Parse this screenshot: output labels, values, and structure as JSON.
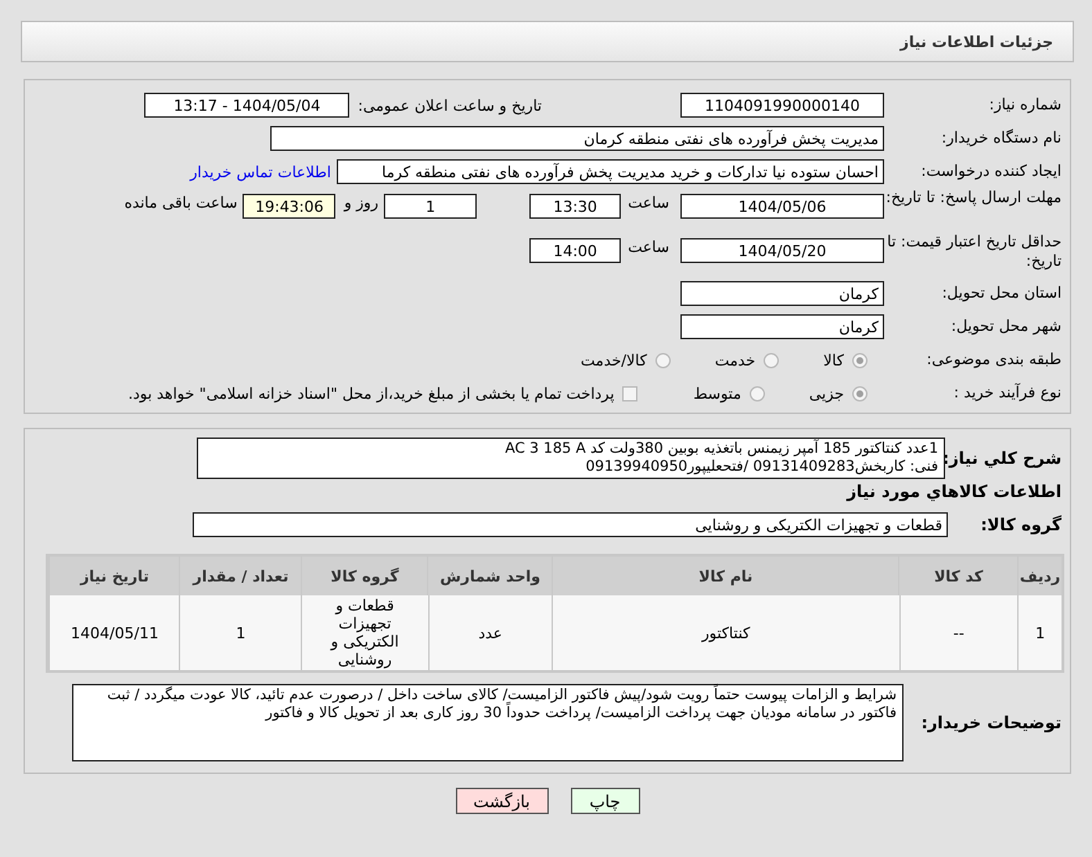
{
  "header": {
    "title": "جزئیات اطلاعات نیاز"
  },
  "need_number": {
    "label": "شماره نیاز:",
    "value": "1104091990000140"
  },
  "announce": {
    "label": "تاریخ و ساعت اعلان عمومی:",
    "value": "1404/05/04 - 13:17"
  },
  "buyer_org": {
    "label": "نام دستگاه خریدار:",
    "value": "مدیریت پخش فرآورده های نفتی منطقه کرمان"
  },
  "requester": {
    "label": "ایجاد کننده درخواست:",
    "value": "احسان  ستوده نیا  تدارکات و خرید  مدیریت پخش فرآورده های نفتی منطقه کرما",
    "link": "اطلاعات تماس خریدار"
  },
  "reply_deadline": {
    "label": "مهلت ارسال پاسخ: تا تاریخ:",
    "date": "1404/05/06",
    "time_label": "ساعت",
    "time": "13:30",
    "days": "1",
    "days_label": "روز و",
    "remaining": "19:43:06",
    "remaining_label": "ساعت باقی مانده"
  },
  "price_validity": {
    "label": "حداقل تاریخ اعتبار قیمت: تا تاریخ:",
    "date": "1404/05/20",
    "time_label": "ساعت",
    "time": "14:00"
  },
  "province": {
    "label": "استان محل تحویل:",
    "value": "کرمان"
  },
  "city": {
    "label": "شهر محل تحویل:",
    "value": "کرمان"
  },
  "category": {
    "label": "طبقه بندی موضوعی:",
    "options": [
      {
        "label": "کالا",
        "selected": true
      },
      {
        "label": "خدمت",
        "selected": false
      },
      {
        "label": "کالا/خدمت",
        "selected": false
      }
    ]
  },
  "purchase_type": {
    "label": "نوع فرآیند خرید :",
    "options": [
      {
        "label": "جزیی",
        "selected": true
      },
      {
        "label": "متوسط",
        "selected": false
      }
    ],
    "treasury": {
      "checked": false,
      "label": "پرداخت تمام یا بخشی از مبلغ خرید،از محل \"اسناد خزانه اسلامی\" خواهد بود."
    }
  },
  "description": {
    "label": "شرح کلي نياز:",
    "text": "1عدد کنتاکتور 185 آمپر زیمنس باتغذیه بوبین 380ولت کد AC 3 185 A\nفنی: کاربخش09131409283 /فتحعلیپور09139940950"
  },
  "goods": {
    "title": "اطلاعات کالاهاي مورد نياز",
    "group_label": "گروه کالا:",
    "group": "قطعات و تجهیزات الکتریکی و روشنایی",
    "table": {
      "columns": [
        "ردیف",
        "کد کالا",
        "نام کالا",
        "واحد شمارش",
        "گروه کالا",
        "تعداد / مقدار",
        "تاریخ نیاز"
      ],
      "rows": [
        [
          "1",
          "--",
          "کنتاکتور",
          "عدد",
          "قطعات و تجهیزات الکتریکی و روشنایی",
          "1",
          "1404/05/11"
        ]
      ]
    }
  },
  "buyer_notes": {
    "label": "توضیحات خریدار:",
    "text": "شرایط و الزامات پیوست حتماً رویت شود/پیش فاکتور الزامیست/ کالای ساخت داخل / درصورت عدم تائید، کالا عودت میگردد / ثبت فاکتور در سامانه مودیان جهت پرداخت الزامیست/ پرداخت حدوداً 30 روز کاری بعد از تحویل کالا و فاکتور"
  },
  "buttons": [
    {
      "label": "چاپ",
      "kind": "print"
    },
    {
      "label": "بازگشت",
      "kind": "back"
    }
  ]
}
